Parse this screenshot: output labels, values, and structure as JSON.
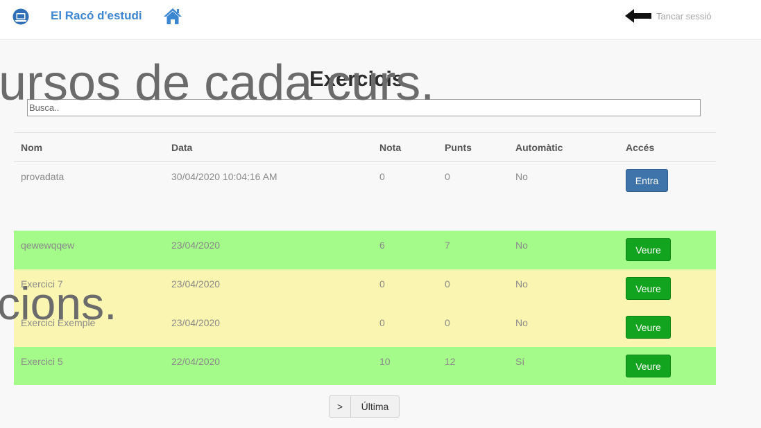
{
  "navbar": {
    "brand": "El Racó d'estudi",
    "logout_label": "Tancar sessió"
  },
  "page": {
    "title": "Exercicis"
  },
  "search": {
    "placeholder": "Busca.."
  },
  "overlay": {
    "line1": "ursos de cada curs.",
    "line2": "cions."
  },
  "table": {
    "headers": [
      "Nom",
      "Data",
      "Nota",
      "Punts",
      "Automàtic",
      "Accés"
    ],
    "rows": [
      {
        "nom": "provadata",
        "data": "30/04/2020 10:04:16 AM",
        "nota": "0",
        "punts": "0",
        "automatic": "No",
        "acces": "Entra",
        "status": "pending"
      },
      {
        "nom": "qewewqqew",
        "data": "23/04/2020",
        "nota": "6",
        "punts": "7",
        "automatic": "No",
        "acces": "Veure",
        "status": "passed"
      },
      {
        "nom": "Exercici 7",
        "data": "23/04/2020",
        "nota": "0",
        "punts": "0",
        "automatic": "No",
        "acces": "Veure",
        "status": "submitted"
      },
      {
        "nom": "Exercici Exemple",
        "data": "23/04/2020",
        "nota": "0",
        "punts": "0",
        "automatic": "No",
        "acces": "Veure",
        "status": "submitted"
      },
      {
        "nom": "Exercici 5",
        "data": "22/04/2020",
        "nota": "10",
        "punts": "12",
        "automatic": "Sí",
        "acces": "Veure",
        "status": "passed"
      }
    ]
  },
  "pagination": {
    "next": ">",
    "last": "Última"
  },
  "colors": {
    "brand": "#3d86d1",
    "row_green": "#a4fb8a",
    "row_yellow": "#fbf5b2",
    "button_blue": "#3f74aa",
    "button_green": "#12a31f"
  },
  "icons": {
    "logo": "laptop-user-icon",
    "home": "home-icon",
    "logout": "arrow-left-icon"
  }
}
